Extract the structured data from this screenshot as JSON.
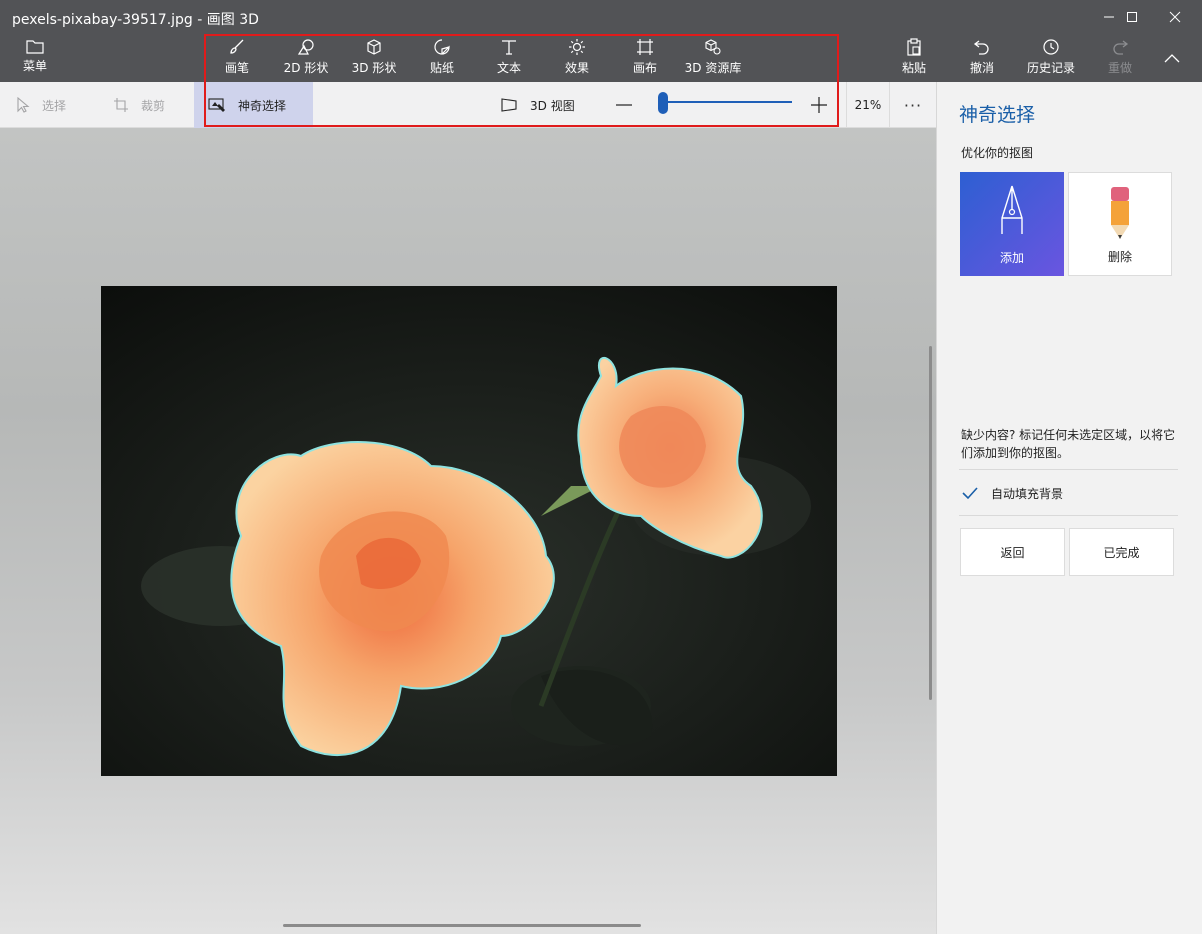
{
  "window": {
    "title": "pexels-pixabay-39517.jpg - 画图 3D"
  },
  "ribbon": {
    "menu_label": "菜单",
    "tools": [
      {
        "label": "画笔",
        "icon": "brush-icon"
      },
      {
        "label": "2D 形状",
        "icon": "2d-shapes-icon"
      },
      {
        "label": "3D 形状",
        "icon": "3d-shapes-icon"
      },
      {
        "label": "贴纸",
        "icon": "sticker-icon"
      },
      {
        "label": "文本",
        "icon": "text-icon"
      },
      {
        "label": "效果",
        "icon": "effects-icon"
      },
      {
        "label": "画布",
        "icon": "canvas-icon"
      },
      {
        "label": "3D 资源库",
        "icon": "3d-library-icon"
      }
    ],
    "paste_label": "粘贴",
    "undo_label": "撤消",
    "history_label": "历史记录",
    "redo_label": "重做"
  },
  "subtoolbar": {
    "select_label": "选择",
    "crop_label": "裁剪",
    "magic_select_label": "神奇选择",
    "view3d_label": "3D 视图",
    "zoom_percent": "21%",
    "zoom_level": 0.21,
    "more_label": "···"
  },
  "panel": {
    "title": "神奇选择",
    "subtitle": "优化你的抠图",
    "add_label": "添加",
    "remove_label": "删除",
    "hint": "缺少内容? 标记任何未选定区域，以将它们添加到你的抠图。",
    "autofill_label": "自动填充背景",
    "autofill_checked": true,
    "back_label": "返回",
    "done_label": "已完成"
  },
  "colors": {
    "ribbon_bg": "#525356",
    "accent_blue": "#1a5fa8",
    "highlight_red": "#e01b1b"
  }
}
